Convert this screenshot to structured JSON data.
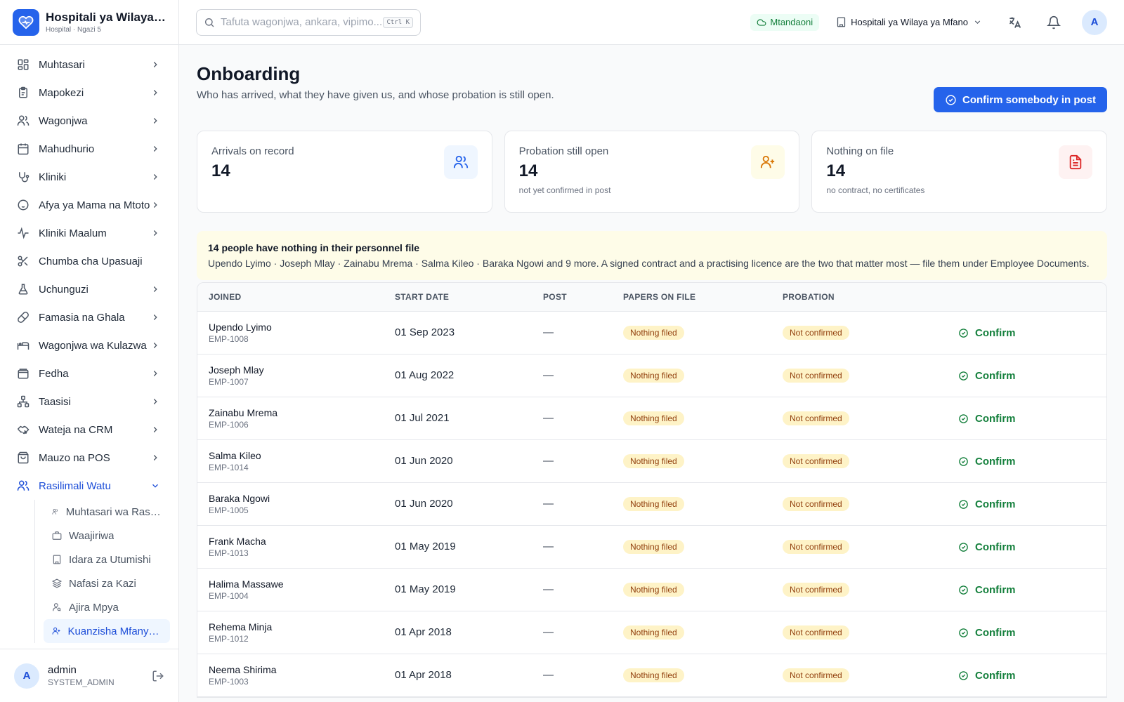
{
  "brand": {
    "title": "Hospitali ya Wilaya ya Mfano",
    "subtitle": "Hospital · Ngazi 5"
  },
  "sidebar": {
    "items": [
      {
        "label": "Muhtasari",
        "icon": "dashboard-icon"
      },
      {
        "label": "Mapokezi",
        "icon": "clipboard-icon"
      },
      {
        "label": "Wagonjwa",
        "icon": "users-icon"
      },
      {
        "label": "Mahudhurio",
        "icon": "calendar-icon"
      },
      {
        "label": "Kliniki",
        "icon": "stethoscope-icon"
      },
      {
        "label": "Afya ya Mama na Mtoto",
        "icon": "baby-icon"
      },
      {
        "label": "Kliniki Maalum",
        "icon": "activity-icon"
      },
      {
        "label": "Chumba cha Upasuaji",
        "icon": "scissors-icon"
      },
      {
        "label": "Uchunguzi",
        "icon": "flask-icon"
      },
      {
        "label": "Famasia na Ghala",
        "icon": "pill-icon"
      },
      {
        "label": "Wagonjwa wa Kulazwa",
        "icon": "bed-icon"
      },
      {
        "label": "Fedha",
        "icon": "wallet-icon"
      },
      {
        "label": "Taasisi",
        "icon": "network-icon"
      },
      {
        "label": "Wateja na CRM",
        "icon": "handshake-icon"
      },
      {
        "label": "Mauzo na POS",
        "icon": "shopping-bag-icon"
      },
      {
        "label": "Rasilimali Watu",
        "icon": "user-icon"
      }
    ],
    "subitems": [
      {
        "label": "Muhtasari wa Rasilimali Watu",
        "icon": "users-icon"
      },
      {
        "label": "Waajiriwa",
        "icon": "briefcase-icon"
      },
      {
        "label": "Idara za Utumishi",
        "icon": "building-icon"
      },
      {
        "label": "Nafasi za Kazi",
        "icon": "layers-icon"
      },
      {
        "label": "Ajira Mpya",
        "icon": "user-search-icon"
      },
      {
        "label": "Kuanzisha Mfanyakazi",
        "icon": "user-plus-icon"
      }
    ]
  },
  "user": {
    "initial": "A",
    "name": "admin",
    "role": "SYSTEM_ADMIN"
  },
  "topbar": {
    "search_placeholder": "Tafuta wagonjwa, ankara, vipimo...",
    "shortcut": "Ctrl K",
    "status": "Mtandaoni",
    "facility": "Hospitali ya Wilaya ya Mfano",
    "avatar": "A"
  },
  "page": {
    "title": "Onboarding",
    "subtitle": "Who has arrived, what they have given us, and whose probation is still open.",
    "primary_action": "Confirm somebody in post"
  },
  "cards": [
    {
      "label": "Arrivals on record",
      "value": "14",
      "note": "",
      "icon": "users-icon",
      "tint": "#eff6ff",
      "color": "#2563eb"
    },
    {
      "label": "Probation still open",
      "value": "14",
      "note": "not yet confirmed in post",
      "icon": "user-plus-icon",
      "tint": "#fefce8",
      "color": "#d97706"
    },
    {
      "label": "Nothing on file",
      "value": "14",
      "note": "no contract, no certificates",
      "icon": "file-text-icon",
      "tint": "#fef2f2",
      "color": "#dc2626"
    }
  ],
  "alert": {
    "title": "14 people have nothing in their personnel file",
    "body": "Upendo Lyimo · Joseph Mlay · Zainabu Mrema · Salma Kileo · Baraka Ngowi and 9 more. A signed contract and a practising licence are the two that matter most — file them under Employee Documents."
  },
  "table": {
    "headers": [
      "Joined",
      "Start date",
      "Post",
      "Papers on file",
      "Probation"
    ],
    "rows": [
      {
        "name": "Upendo Lyimo",
        "id": "EMP-1008",
        "start": "01 Sep 2023",
        "post": "—",
        "papers": "Nothing filed",
        "probation": "Not confirmed",
        "action": "Confirm"
      },
      {
        "name": "Joseph Mlay",
        "id": "EMP-1007",
        "start": "01 Aug 2022",
        "post": "—",
        "papers": "Nothing filed",
        "probation": "Not confirmed",
        "action": "Confirm"
      },
      {
        "name": "Zainabu Mrema",
        "id": "EMP-1006",
        "start": "01 Jul 2021",
        "post": "—",
        "papers": "Nothing filed",
        "probation": "Not confirmed",
        "action": "Confirm"
      },
      {
        "name": "Salma Kileo",
        "id": "EMP-1014",
        "start": "01 Jun 2020",
        "post": "—",
        "papers": "Nothing filed",
        "probation": "Not confirmed",
        "action": "Confirm"
      },
      {
        "name": "Baraka Ngowi",
        "id": "EMP-1005",
        "start": "01 Jun 2020",
        "post": "—",
        "papers": "Nothing filed",
        "probation": "Not confirmed",
        "action": "Confirm"
      },
      {
        "name": "Frank Macha",
        "id": "EMP-1013",
        "start": "01 May 2019",
        "post": "—",
        "papers": "Nothing filed",
        "probation": "Not confirmed",
        "action": "Confirm"
      },
      {
        "name": "Halima Massawe",
        "id": "EMP-1004",
        "start": "01 May 2019",
        "post": "—",
        "papers": "Nothing filed",
        "probation": "Not confirmed",
        "action": "Confirm"
      },
      {
        "name": "Rehema Minja",
        "id": "EMP-1012",
        "start": "01 Apr 2018",
        "post": "—",
        "papers": "Nothing filed",
        "probation": "Not confirmed",
        "action": "Confirm"
      },
      {
        "name": "Neema Shirima",
        "id": "EMP-1003",
        "start": "01 Apr 2018",
        "post": "—",
        "papers": "Nothing filed",
        "probation": "Not confirmed",
        "action": "Confirm"
      }
    ]
  },
  "colors": {
    "accent": "#2563eb",
    "success": "#15803d",
    "warning_bg": "#fef3c7",
    "warning_text": "#92400e"
  }
}
